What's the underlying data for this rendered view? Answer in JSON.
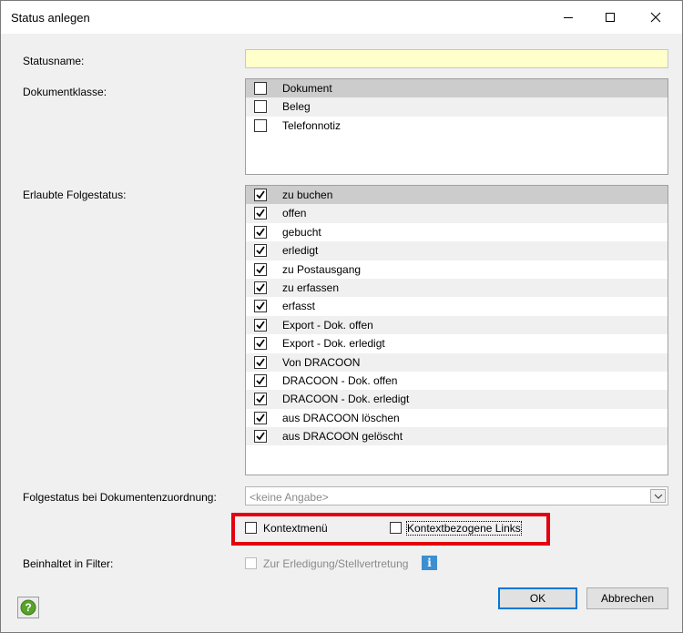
{
  "window": {
    "title": "Status anlegen"
  },
  "fields": {
    "statusname_label": "Statusname:",
    "statusname_value": "",
    "dokumentklasse_label": "Dokumentklasse:",
    "folgestatus_label": "Erlaubte Folgestatus:",
    "zuordnung_label": "Folgestatus bei Dokumentenzuordnung:",
    "zuordnung_value": "<keine Angabe>",
    "filter_label": "Beinhaltet in Filter:"
  },
  "dokumentklassen": [
    {
      "label": "Dokument",
      "checked": false
    },
    {
      "label": "Beleg",
      "checked": false
    },
    {
      "label": "Telefonnotiz",
      "checked": false
    }
  ],
  "folgestatus": [
    {
      "label": "zu buchen",
      "checked": true
    },
    {
      "label": "offen",
      "checked": true
    },
    {
      "label": "gebucht",
      "checked": true
    },
    {
      "label": "erledigt",
      "checked": true
    },
    {
      "label": "zu Postausgang",
      "checked": true
    },
    {
      "label": "zu erfassen",
      "checked": true
    },
    {
      "label": "erfasst",
      "checked": true
    },
    {
      "label": "Export - Dok. offen",
      "checked": true
    },
    {
      "label": "Export - Dok. erledigt",
      "checked": true
    },
    {
      "label": "Von DRACOON",
      "checked": true
    },
    {
      "label": "DRACOON - Dok. offen",
      "checked": true
    },
    {
      "label": "DRACOON - Dok. erledigt",
      "checked": true
    },
    {
      "label": "aus DRACOON löschen",
      "checked": true
    },
    {
      "label": "aus DRACOON gelöscht",
      "checked": true
    }
  ],
  "options": {
    "kontextmenu_label": "Kontextmenü",
    "kontextmenu_checked": false,
    "links_label": "Kontextbezogene Links",
    "links_checked": false,
    "filter_option_label": "Zur Erledigung/Stellvertretung",
    "filter_option_checked": false,
    "filter_option_enabled": false
  },
  "buttons": {
    "ok": "OK",
    "cancel": "Abbrechen"
  },
  "icons": {
    "help": "help-icon",
    "info": "info-icon",
    "dropdown": "chevron-down-icon"
  },
  "colors": {
    "highlight_border": "#e3000f",
    "required_field": "#ffffcc",
    "default_button_border": "#0078d7",
    "help_green": "#58a22a",
    "info_blue": "#3c8fd0"
  }
}
